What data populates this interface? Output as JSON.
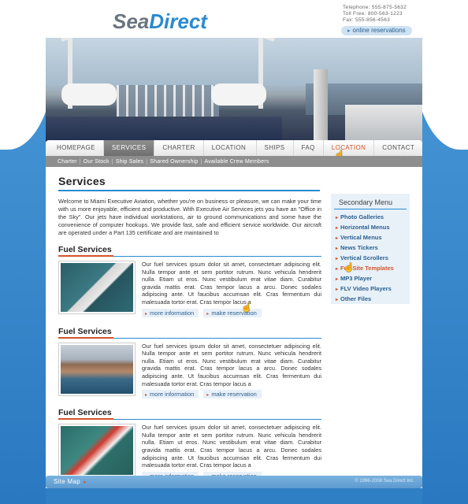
{
  "logo": {
    "part1": "Sea",
    "part2": "Direct"
  },
  "contact": {
    "telephone": "Telephone: 555-875-5632",
    "tollfree": "Toll Free: 800-563-1223",
    "fax": "Fax: 555-856-4563"
  },
  "online_reservations": "online reservations",
  "nav": {
    "items": [
      "HOMEPAGE",
      "SERVICES",
      "CHARTER",
      "LOCATION INFO",
      "SHIPS",
      "FAQ",
      "LOCATION",
      "CONTACT US"
    ]
  },
  "subnav": {
    "items": [
      "Charter",
      "Our Stock",
      "Ship Sales",
      "Shared Ownership",
      "Available Crew Members"
    ]
  },
  "main": {
    "title": "Services",
    "intro": "Welcome to Miami Executive Aviation, whether you're on business or pleasure, we can make your time with us more enjoyable, efficient and productive. With Executive Air Services jets you have an \"Office in the Sky\". Our jets have individual workstations, air to ground communications and some have the convenience of computer hookups. We provide fast, safe and efficient service worldwide. Our aircraft are operated under a Part 135 certificate and are maintained to",
    "sections": [
      {
        "title": "Fuel Services",
        "text": "Our fuel services ipsum dolor sit amet, consectetuer adipiscing elit. Nulla tempor ante et sem portitor rutrum. Nunc vehicula hendrerit nulla. Etiam ut eros. Nunc vestibulum erat vitae diam. Curabitur gravida mattis erat. Cras tempor lacus a arcu. Donec sodales adipiscing ante. Ut faucibus accumsan elit. Cras fermentum dui malesuada tortor erat. Cras tempor lacus a",
        "more": "more information",
        "reserve": "make reservation"
      },
      {
        "title": "Fuel Services",
        "text": "Our fuel services ipsum dolor sit amet, consectetuer adipiscing elit. Nulla tempor ante et sem portitor rutrum. Nunc vehicula hendrerit nulla. Etiam ut eros. Nunc vestibulum erat vitae diam. Curabitur gravida mattis erat. Cras tempor lacus a arcu. Donec sodales adipiscing ante. Ut faucibus accumsan elit. Cras fermentum dui malesuada tortor erat. Cras tempor lacus a",
        "more": "more information",
        "reserve": "make reservation"
      },
      {
        "title": "Fuel Services",
        "text": "Our fuel services ipsum dolor sit amet, consectetuer adipiscing elit. Nulla tempor ante et sem portitor rutrum. Nunc vehicula hendrerit nulla. Etiam ut eros. Nunc vestibulum erat vitae diam. Curabitur gravida mattis erat. Cras tempor lacus a arcu. Donec sodales adipiscing ante. Ut faucibus accumsan elit. Cras fermentum dui malesuada tortor erat. Cras tempor lacus a",
        "more": "more information",
        "reserve": "make reservation"
      }
    ]
  },
  "sidebar": {
    "title": "Secondary Menu",
    "items": [
      "Photo Galleries",
      "Horizontal Menus",
      "Vertical Menus",
      "News Tickers",
      "Vertical Scrollers",
      "Full Site Templates",
      "MP3 Player",
      "FLV Video Players",
      "Other Files"
    ]
  },
  "footer": {
    "sitemap": "Site Map",
    "copyright": "© 1996-2008 Sea Direct Inc."
  },
  "colors": {
    "accent_blue": "#2a8ad0",
    "accent_orange": "#d4552a",
    "nav_active": "#7f7f7f"
  }
}
